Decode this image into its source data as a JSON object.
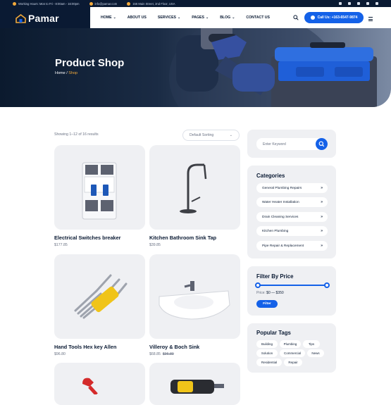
{
  "topbar": {
    "hours": "Working Hours: Mon to Fri - 8:00am - 16:00pm",
    "email": "info@pamar.com",
    "address": "156 Main Street, 2nd Floor, USA",
    "social_icons": [
      "facebook-icon",
      "twitter-icon",
      "instagram-icon",
      "linkedin-icon",
      "youtube-icon"
    ]
  },
  "header": {
    "logo_text": "Pamar",
    "nav": [
      {
        "label": "HOME",
        "has_caret": true
      },
      {
        "label": "ABOUT US",
        "has_caret": false
      },
      {
        "label": "SERVICES",
        "has_caret": true
      },
      {
        "label": "PAGES",
        "has_caret": true
      },
      {
        "label": "BLOG",
        "has_caret": true
      },
      {
        "label": "CONTACT US",
        "has_caret": false
      }
    ],
    "caret": "⌄",
    "call_label": "Call Us: +163-6547-9874"
  },
  "hero": {
    "title": "Product Shop",
    "crumb_home": "Home",
    "crumb_sep": "/",
    "crumb_current": "Shop"
  },
  "shop": {
    "showing": "Showing 1–12 of 16 results",
    "sort_label": "Default Sorting",
    "sort_caret": "⌄",
    "products": [
      {
        "name": "Electrical Switches breaker",
        "price": "$177.85",
        "old_price": ""
      },
      {
        "name": "Kitchen Bathroom Sink Tap",
        "price": "$39.85",
        "old_price": ""
      },
      {
        "name": "Hand Tools Hex key Allen",
        "price": "$96.80",
        "old_price": ""
      },
      {
        "name": "Villeroy & Boch Sink",
        "price": "$68.85",
        "old_price": "$96.89"
      }
    ]
  },
  "sidebar": {
    "search_placeholder": "Enter Keyword",
    "categories_title": "Categories",
    "categories": [
      "General Plumbing Repairs",
      "Water Heater Installation",
      "Drain Cleaning Services",
      "Kitchen Plumbing",
      "Pipe Repair & Replacement"
    ],
    "cat_arrow": "»",
    "filter_title": "Filter By Price",
    "price_label": "Price:",
    "price_range": "$0 — $350",
    "filter_button": "Filter",
    "tags_title": "Popular Tags",
    "tags": [
      "Building",
      "Plumbing",
      "Tips",
      "Solution",
      "Commercial",
      "News",
      "Residential",
      "Repair"
    ]
  },
  "colors": {
    "accent": "#1461e8",
    "dark": "#0a1a33",
    "highlight": "#f2a93b",
    "card_bg": "#eff0f3"
  }
}
